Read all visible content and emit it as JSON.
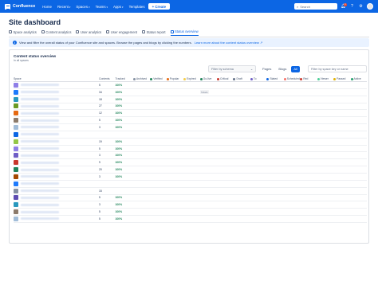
{
  "topbar": {
    "app_name": "Confluence",
    "nav": [
      "Home",
      "Recent",
      "Spaces",
      "Teams",
      "Apps",
      "Templates"
    ],
    "nav_dropdowns": [
      false,
      true,
      true,
      true,
      true,
      false
    ],
    "create_label": "+ Create",
    "search_placeholder": "Search",
    "notification_count": "1",
    "icons": [
      "grid-icon",
      "search-icon",
      "bell-icon",
      "help-icon",
      "settings-icon",
      "avatar"
    ]
  },
  "page": {
    "title": "Site dashboard"
  },
  "tabs": [
    {
      "label": "Space analytics",
      "active": false
    },
    {
      "label": "Content analytics",
      "active": false
    },
    {
      "label": "User analytics",
      "active": false
    },
    {
      "label": "User engagement",
      "active": false
    },
    {
      "label": "Status report",
      "active": false
    },
    {
      "label": "Status overview",
      "active": true
    }
  ],
  "info_banner": {
    "text": "View and filter the overall status of your Confluence site and spaces. Browse the pages and blogs by clicking the numbers.",
    "link": "Learn more about the content status overview ↗"
  },
  "panel": {
    "title": "Content status overview",
    "subtitle": "In all spaces",
    "filter_select": "Filter by schema",
    "segments": [
      "Pages",
      "Blogs",
      "All"
    ],
    "selected_segment": "All",
    "filter_input_placeholder": "Filter by space key or name",
    "headers": [
      "Space",
      "Contents",
      "Tracked",
      "Archived",
      "Verified",
      "Popular",
      "Expired",
      "Go-live",
      "Critical",
      "Draft",
      "To",
      "Stated",
      "Scheduled",
      "Red",
      "Viewer",
      "Passed",
      "Active"
    ],
    "status_colors": [
      "#8590a2",
      "#1f845a",
      "#e56910",
      "#f5cd47",
      "#1f845a",
      "#c9372c",
      "#626f86",
      "#6e5dc6",
      "#0c66e4",
      "#f87168",
      "#c9372c",
      "#4bce97",
      "#e2b203",
      "#22a06b"
    ],
    "rows": [
      {
        "icon": "#8f7ee7",
        "contents": "5",
        "tracked": "100%",
        "cells": [
          "",
          "",
          "",
          "",
          "",
          "",
          "",
          "",
          "",
          "",
          "",
          "",
          "",
          ""
        ]
      },
      {
        "icon": "#1d7afc",
        "contents": "34",
        "tracked": "100%",
        "cells": [
          "",
          "",
          "",
          "",
          "5 docs",
          "",
          "",
          "",
          "",
          "",
          "",
          "",
          "",
          ""
        ]
      },
      {
        "icon": "#2898bd",
        "contents": "18",
        "tracked": "100%",
        "cells": [
          "",
          "",
          "",
          "",
          "",
          "",
          "",
          "",
          "",
          "",
          "",
          "",
          "",
          ""
        ]
      },
      {
        "icon": "#6a9a23",
        "contents": "27",
        "tracked": "100%",
        "cells": [
          "",
          "",
          "",
          "",
          "",
          "",
          "",
          "",
          "",
          "",
          "",
          "",
          "",
          ""
        ]
      },
      {
        "icon": "#e56910",
        "contents": "12",
        "tracked": "100%",
        "cells": [
          "",
          "",
          "",
          "",
          "",
          "",
          "",
          "",
          "",
          "",
          "",
          "",
          "",
          ""
        ]
      },
      {
        "icon": "#8c7b6b",
        "contents": "5",
        "tracked": "100%",
        "cells": [
          "",
          "",
          "",
          "",
          "",
          "",
          "",
          "",
          "",
          "",
          "",
          "",
          "",
          ""
        ]
      },
      {
        "icon": "#a1bdd9",
        "contents": "3",
        "tracked": "100%",
        "cells": [
          "",
          "",
          "",
          "",
          "",
          "",
          "",
          "",
          "",
          "",
          "",
          "",
          "",
          ""
        ]
      },
      {
        "icon": "#0c66e4",
        "contents": "",
        "tracked": "",
        "cells": [
          "",
          "",
          "",
          "",
          "",
          "",
          "",
          "",
          "",
          "",
          "",
          "",
          "",
          ""
        ]
      },
      {
        "icon": "#94c748",
        "contents": "19",
        "tracked": "100%",
        "cells": [
          "",
          "",
          "",
          "",
          "",
          "",
          "",
          "",
          "",
          "",
          "",
          "",
          "",
          ""
        ]
      },
      {
        "icon": "#8f7ee7",
        "contents": "5",
        "tracked": "100%",
        "cells": [
          "",
          "",
          "",
          "",
          "",
          "",
          "",
          "",
          "",
          "",
          "",
          "",
          "",
          ""
        ]
      },
      {
        "icon": "#6e5dc6",
        "contents": "3",
        "tracked": "100%",
        "cells": [
          "",
          "",
          "",
          "",
          "",
          "",
          "",
          "",
          "",
          "",
          "",
          "",
          "",
          ""
        ]
      },
      {
        "icon": "#c9372c",
        "contents": "9",
        "tracked": "100%",
        "cells": [
          "",
          "",
          "",
          "",
          "",
          "",
          "",
          "",
          "",
          "",
          "",
          "",
          "",
          ""
        ]
      },
      {
        "icon": "#1f845a",
        "contents": "20",
        "tracked": "100%",
        "cells": [
          "",
          "",
          "",
          "",
          "",
          "",
          "",
          "",
          "",
          "",
          "",
          "",
          "",
          ""
        ]
      },
      {
        "icon": "#a54800",
        "contents": "3",
        "tracked": "100%",
        "cells": [
          "",
          "",
          "",
          "",
          "",
          "",
          "",
          "",
          "",
          "",
          "",
          "",
          "",
          ""
        ]
      },
      {
        "icon": "#1d7afc",
        "contents": "",
        "tracked": "",
        "cells": [
          "",
          "",
          "",
          "",
          "",
          "",
          "",
          "",
          "",
          "",
          "",
          "",
          "",
          ""
        ]
      },
      {
        "icon": "#8590a2",
        "contents": "15",
        "tracked": "",
        "cells": [
          "",
          "",
          "",
          "",
          "",
          "",
          "",
          "",
          "",
          "",
          "",
          "",
          "",
          ""
        ]
      },
      {
        "icon": "#5e4db2",
        "contents": "5",
        "tracked": "100%",
        "cells": [
          "",
          "",
          "",
          "",
          "",
          "",
          "",
          "",
          "",
          "",
          "",
          "",
          "",
          ""
        ]
      },
      {
        "icon": "#2898bd",
        "contents": "3",
        "tracked": "100%",
        "cells": [
          "",
          "",
          "",
          "",
          "",
          "",
          "",
          "",
          "",
          "",
          "",
          "",
          "",
          ""
        ]
      },
      {
        "icon": "#8c7b6b",
        "contents": "5",
        "tracked": "100%",
        "cells": [
          "",
          "",
          "",
          "",
          "",
          "",
          "",
          "",
          "",
          "",
          "",
          "",
          "",
          ""
        ]
      },
      {
        "icon": "#a1bdd9",
        "contents": "5",
        "tracked": "100%",
        "cells": [
          "",
          "",
          "",
          "",
          "",
          "",
          "",
          "",
          "",
          "",
          "",
          "",
          "",
          ""
        ]
      }
    ]
  }
}
